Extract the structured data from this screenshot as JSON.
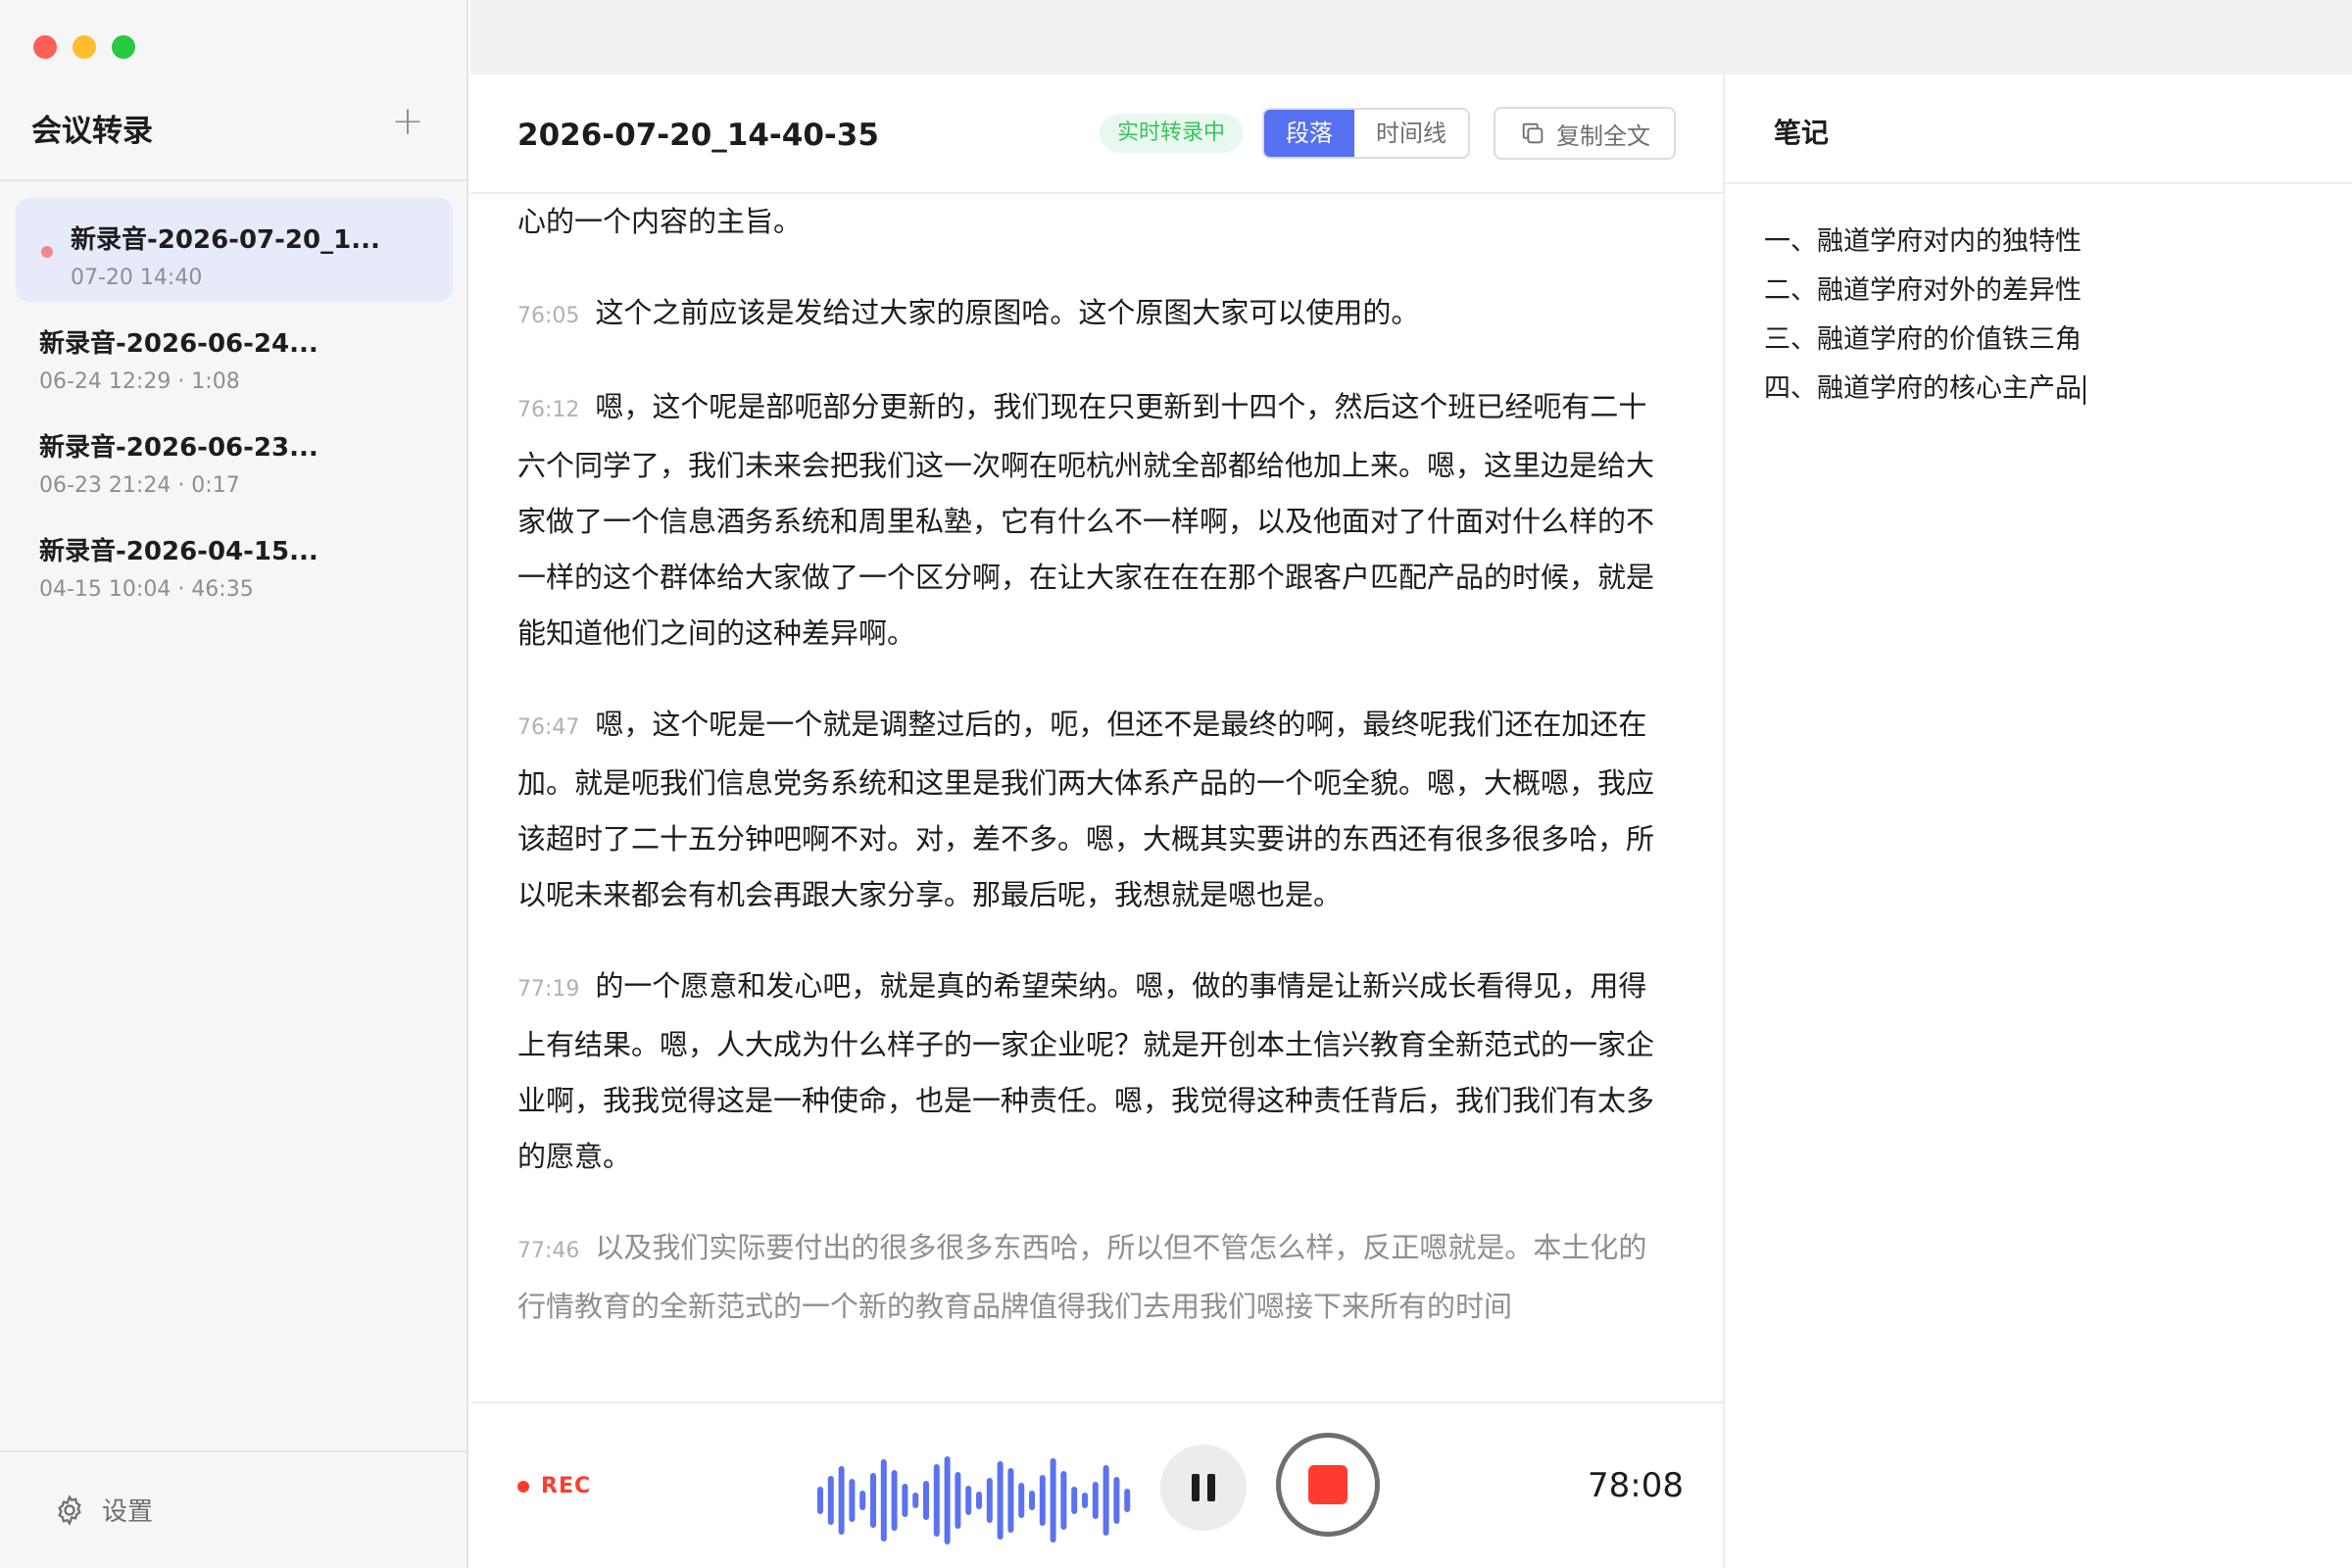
{
  "window": {
    "traffic_colors": [
      "#ff5f57",
      "#febc2e",
      "#28c840"
    ]
  },
  "sidebar": {
    "title": "会议转录",
    "add_icon": "+",
    "items": [
      {
        "title": "新录音-2026-07-20_1...",
        "meta": "07-20 14:40",
        "active": true
      },
      {
        "title": "新录音-2026-06-24...",
        "meta": "06-24 12:29 · 1:08",
        "active": false
      },
      {
        "title": "新录音-2026-06-23...",
        "meta": "06-23 21:24 · 0:17",
        "active": false
      },
      {
        "title": "新录音-2026-04-15...",
        "meta": "04-15 10:04 · 46:35",
        "active": false
      }
    ],
    "settings_label": "设置",
    "settings_icon": "gear-icon"
  },
  "header": {
    "recording_name": "2026-07-20_14-40-35",
    "live_badge": "实时转录中",
    "view_tabs": [
      {
        "label": "段落",
        "active": true
      },
      {
        "label": "时间线",
        "active": false
      }
    ],
    "copy_label": "复制全文",
    "copy_icon": "copy-icon"
  },
  "transcript": {
    "paragraphs": [
      {
        "ts": "",
        "text": "心的一个内容的主旨。"
      },
      {
        "ts": "76:05",
        "text": "这个之前应该是发给过大家的原图哈。这个原图大家可以使用的。"
      },
      {
        "ts": "76:12",
        "text": "嗯，这个呢是部呃部分更新的，我们现在只更新到十四个，然后这个班已经呃有二十六个同学了，我们未来会把我们这一次啊在呃杭州就全部都给他加上来。嗯，这里边是给大家做了一个信息酒务系统和周里私塾，它有什么不一样啊，以及他面对了什面对什么样的不一样的这个群体给大家做了一个区分啊，在让大家在在在那个跟客户匹配产品的时候，就是能知道他们之间的这种差异啊。"
      },
      {
        "ts": "76:47",
        "text": "嗯，这个呢是一个就是调整过后的，呃，但还不是最终的啊，最终呢我们还在加还在加。就是呃我们信息党务系统和这里是我们两大体系产品的一个呃全貌。嗯，大概嗯，我应该超时了二十五分钟吧啊不对。对，差不多。嗯，大概其实要讲的东西还有很多很多哈，所以呢未来都会有机会再跟大家分享。那最后呢，我想就是嗯也是。"
      },
      {
        "ts": "77:19",
        "text": "的一个愿意和发心吧，就是真的希望荣纳。嗯，做的事情是让新兴成长看得见，用得上有结果。嗯，人大成为什么样子的一家企业呢？就是开创本土信兴教育全新范式的一家企业啊，我我觉得这是一种使命，也是一种责任。嗯，我觉得这种责任背后，我们我们有太多的愿意。"
      },
      {
        "ts": "77:46",
        "text": "以及我们实际要付出的很多很多东西哈，所以但不管怎么样，反正嗯就是。本土化的行情教育的全新范式的一个新的教育品牌值得我们去用我们嗯接下来所有的时间",
        "pending": true
      }
    ]
  },
  "footer": {
    "rec_label": "REC",
    "timer": "78:08",
    "wave_color": "#5b73ee",
    "stop_color": "#ff3b30"
  },
  "notes": {
    "title": "笔记",
    "lines": [
      "一、融道学府对内的独特性",
      "二、融道学府对外的差异性",
      "三、融道学府的价值铁三角",
      "四、融道学府的核心主产品"
    ]
  }
}
